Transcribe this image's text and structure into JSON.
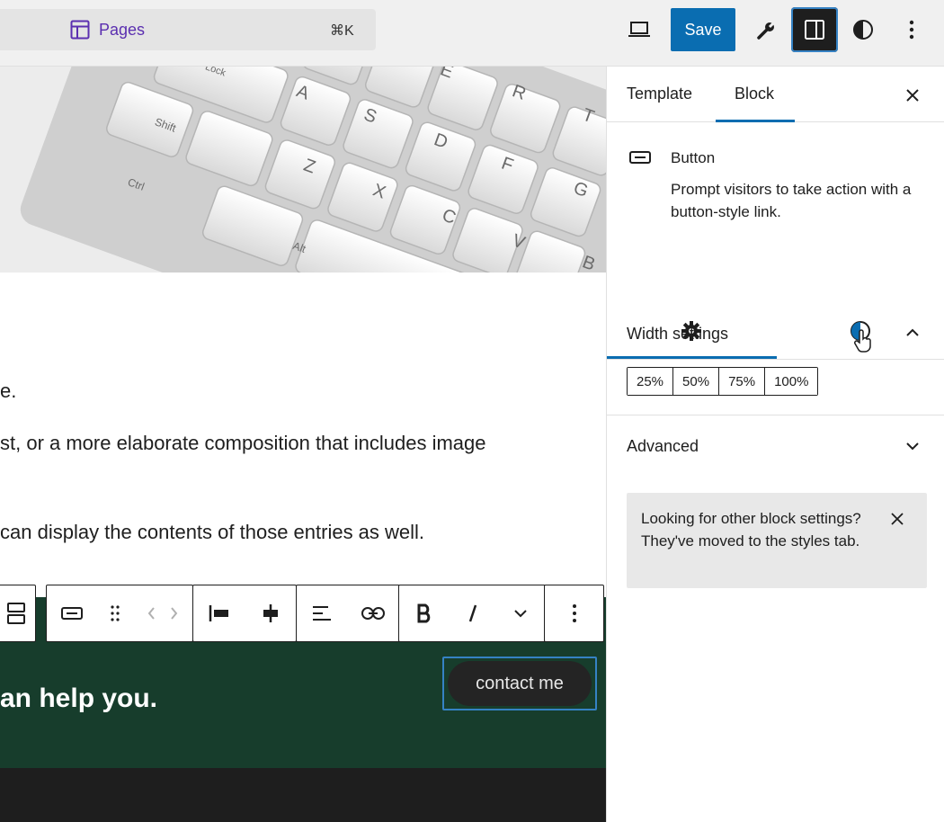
{
  "topbar": {
    "command": {
      "label": "Pages",
      "shortcut": "⌘K"
    },
    "save_label": "Save"
  },
  "canvas": {
    "paragraphs": [
      "e.",
      "st, or a more elaborate composition that includes image",
      "can display the contents of those entries as well."
    ],
    "cta_heading": "an help you.",
    "contact_button": "contact me",
    "keyboard_keys": [
      "Lock",
      "A",
      "S",
      "D",
      "E",
      "F",
      "R",
      "G",
      "T",
      "Shift",
      "Z",
      "X",
      "C",
      "V",
      "Ctrl",
      "Alt",
      "B"
    ]
  },
  "sidebar": {
    "tabs": [
      {
        "label": "Template"
      },
      {
        "label": "Block"
      }
    ],
    "active_tab": "Block",
    "block": {
      "title": "Button",
      "description": "Prompt visitors to take action with a button-style link."
    },
    "sub_tabs": [
      "settings",
      "styles"
    ],
    "active_sub_tab": "settings",
    "width_settings": {
      "title": "Width settings",
      "options": [
        "25%",
        "50%",
        "75%",
        "100%"
      ]
    },
    "advanced": {
      "title": "Advanced"
    },
    "notice": "Looking for other block settings? They've moved to the styles tab."
  },
  "colors": {
    "accent": "#0a6db1",
    "pages_purple": "#5b2fb0",
    "cta_background": "#173d2c",
    "footer_background": "#1e1e1e"
  }
}
